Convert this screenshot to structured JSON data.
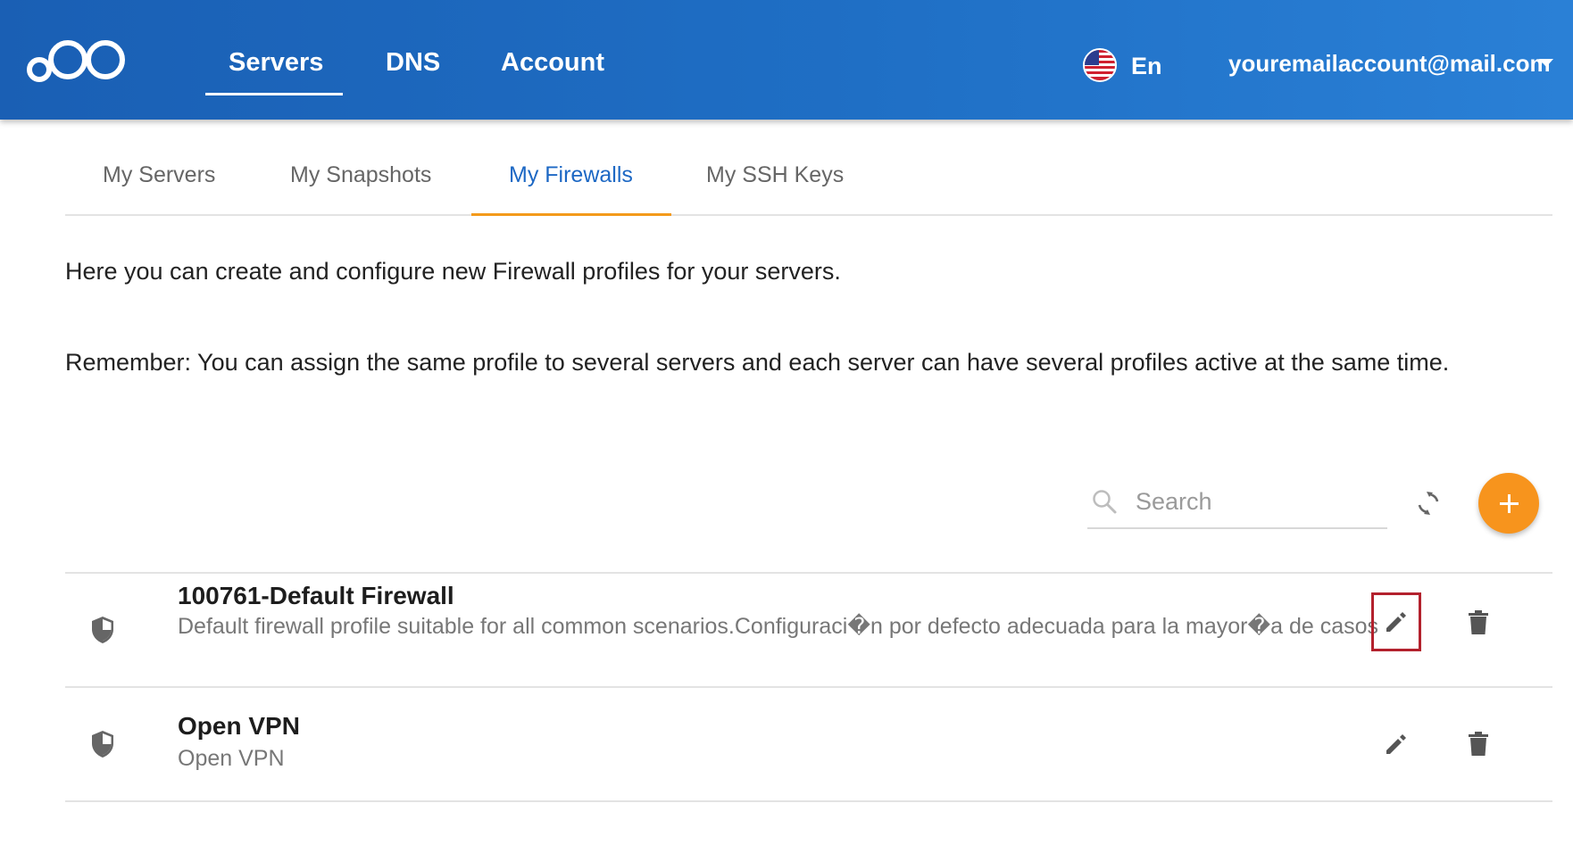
{
  "nav": {
    "items": [
      {
        "label": "Servers",
        "active": true
      },
      {
        "label": "DNS",
        "active": false
      },
      {
        "label": "Account",
        "active": false
      }
    ],
    "language": "En",
    "flag_icon": "us-flag-icon",
    "user_email": "youremailaccount@mail.com"
  },
  "tabs": [
    {
      "label": "My Servers",
      "active": false
    },
    {
      "label": "My Snapshots",
      "active": false
    },
    {
      "label": "My Firewalls",
      "active": true
    },
    {
      "label": "My SSH Keys",
      "active": false
    }
  ],
  "content": {
    "intro": "Here you can create and configure new Firewall profiles for your servers.",
    "remember": "Remember: You can assign the same profile to several servers and each server can have several profiles active at the same time."
  },
  "toolbar": {
    "search_placeholder": "Search",
    "search_value": ""
  },
  "firewalls": [
    {
      "name": "100761-Default Firewall",
      "description": "Default firewall profile suitable for all common scenarios.Configuraci�n por defecto adecuada para la mayor�a de casos"
    },
    {
      "name": "Open VPN",
      "description": "Open VPN"
    }
  ],
  "colors": {
    "header_blue": "#1a5fb4",
    "tab_active": "#1d68c4",
    "accent_orange": "#f7941d",
    "highlight_red": "#b3212d"
  }
}
